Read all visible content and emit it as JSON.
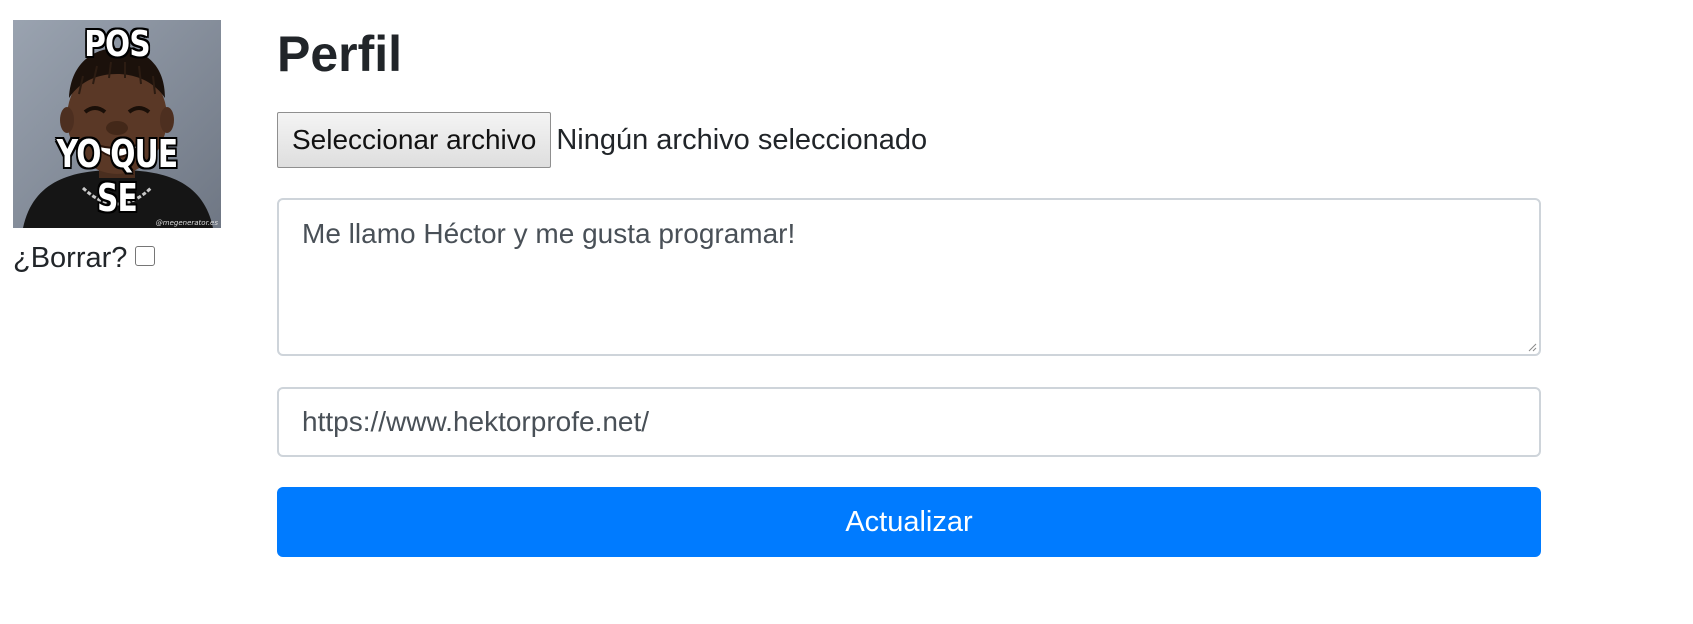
{
  "avatar": {
    "top_caption": "POS",
    "bottom_caption": "YO QUE SE",
    "watermark": "@megenerator.es"
  },
  "delete_label": "¿Borrar?",
  "delete_checked": false,
  "title": "Perfil",
  "file_input": {
    "button_label": "Seleccionar archivo",
    "status": "Ningún archivo seleccionado"
  },
  "bio": {
    "value": "Me llamo Héctor y me gusta programar!"
  },
  "website": {
    "value": "https://www.hektorprofe.net/"
  },
  "submit_label": "Actualizar",
  "colors": {
    "primary": "#007bff",
    "border": "#ced4da",
    "text": "#212529"
  }
}
